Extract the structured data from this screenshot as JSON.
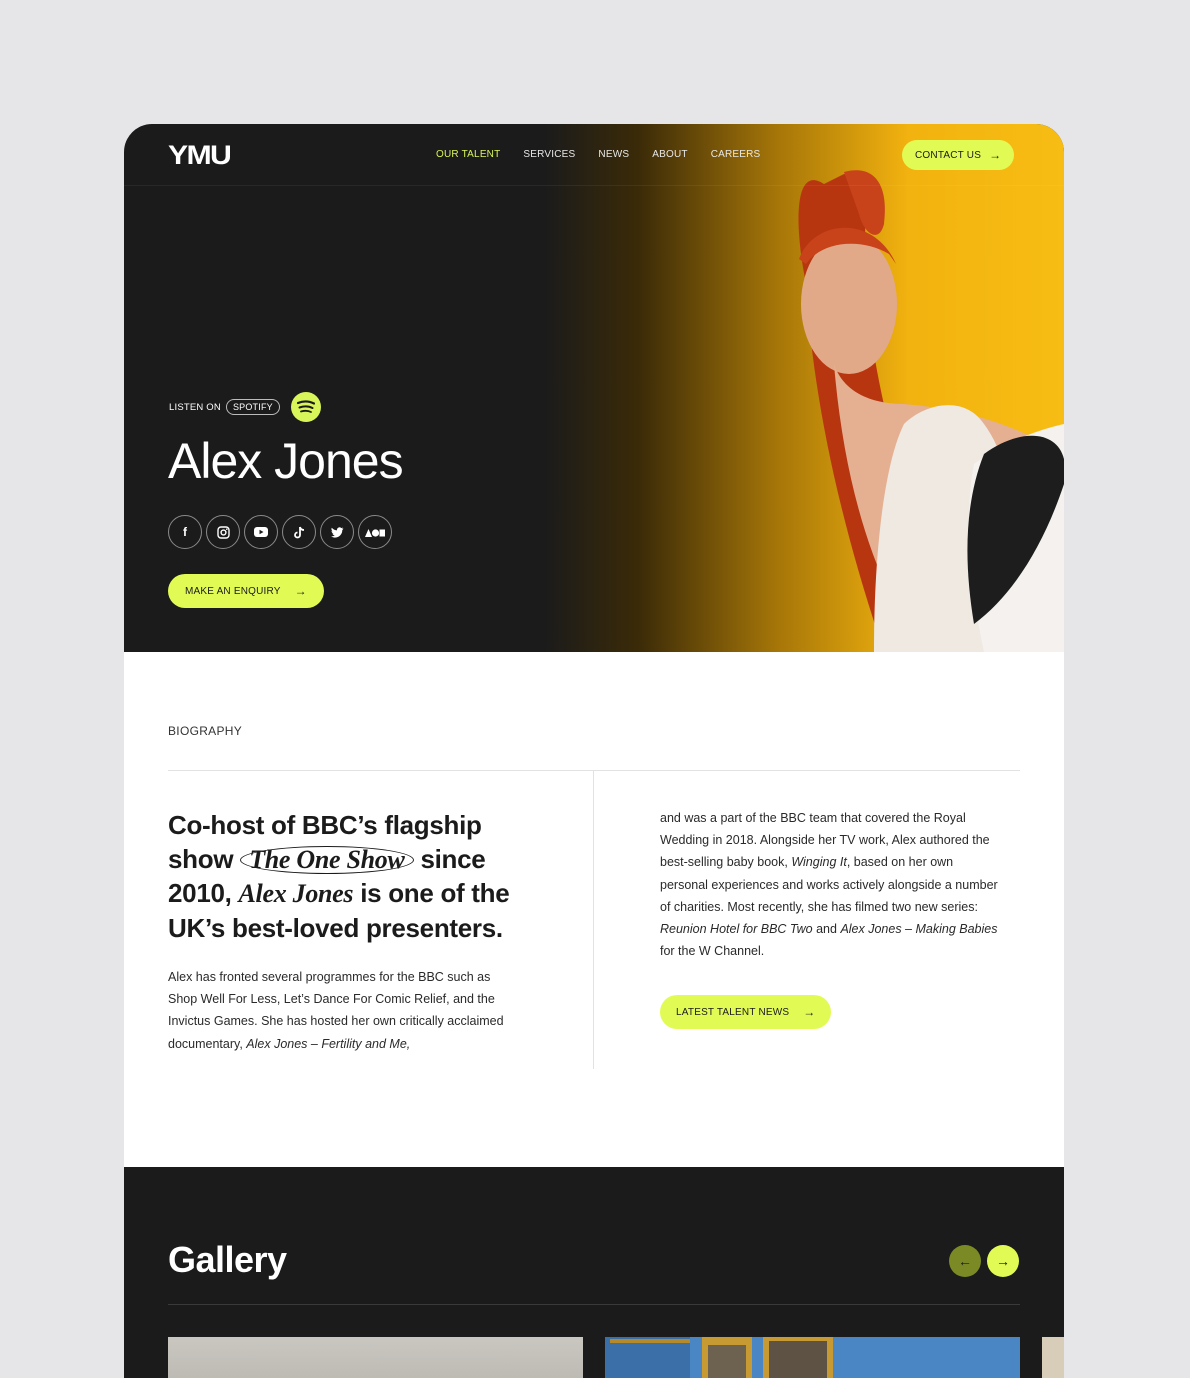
{
  "brand": {
    "logo": "YMU"
  },
  "nav": {
    "links": [
      "OUR TALENT",
      "SERVICES",
      "NEWS",
      "ABOUT",
      "CAREERS"
    ],
    "active_index": 0,
    "contact_label": "CONTACT US"
  },
  "hero": {
    "listen_on": "LISTEN ON",
    "listen_platform": "SPOTIFY",
    "name": "Alex Jones",
    "socials": [
      "facebook-icon",
      "instagram-icon",
      "youtube-icon",
      "tiktok-icon",
      "twitter-icon",
      "acast-icon"
    ],
    "enquiry_label": "MAKE AN ENQUIRY"
  },
  "bio": {
    "label": "BIOGRAPHY",
    "headline_part1": "Co-host of BBC’s flagship show",
    "headline_show": "The One Show",
    "headline_part2": "since 2010,",
    "headline_name": "Alex Jones",
    "headline_part3": "is one of the UK’s best-loved presenters.",
    "left_text": "Alex has fronted several programmes for the BBC such as Shop Well For Less, Let’s Dance For Comic Relief, and the Invictus Games. She has hosted her own critically acclaimed documentary, ",
    "left_italic": "Alex Jones – Fertility and Me,",
    "right_text_1": "and was a part of the BBC team that covered the Royal Wedding in 2018. Alongside her TV work, Alex authored the best-selling baby book, ",
    "right_italic_1": "Winging It",
    "right_text_2": ", based on her own personal experiences and works actively alongside a number of charities. Most recently, she has filmed two new series: ",
    "right_italic_2": "Reunion Hotel for BBC Two",
    "right_text_3": " and ",
    "right_italic_3": "Alex Jones – Making Babies",
    "right_text_4": " for the W Channel.",
    "news_label": "LATEST TALENT NEWS"
  },
  "gallery": {
    "title": "Gallery"
  },
  "colors": {
    "accent": "#e2fb54",
    "dark": "#1b1b1b",
    "hero_yellow": "#f7bd14"
  }
}
